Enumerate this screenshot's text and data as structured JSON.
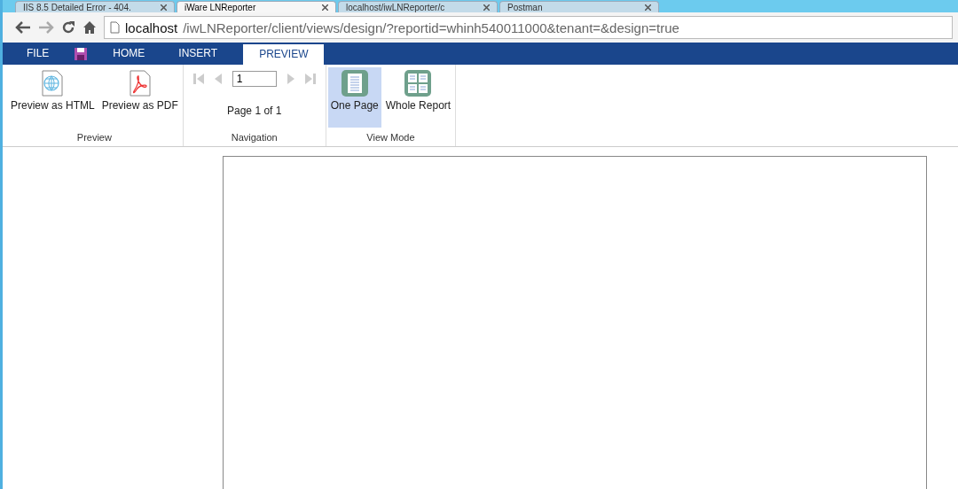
{
  "browser_tabs": [
    {
      "title": "IIS 8.5 Detailed Error - 404.",
      "selected": false
    },
    {
      "title": "iWare LNReporter",
      "selected": true
    },
    {
      "title": "localhost/iwLNReporter/c",
      "selected": false
    },
    {
      "title": "Postman",
      "selected": false
    }
  ],
  "address": {
    "host": "localhost",
    "path": "/iwLNReporter/client/views/design/?reportid=whinh540011000&tenant=&design=true"
  },
  "menu_tabs": [
    {
      "kind": "text",
      "label": "FILE",
      "selected": false
    },
    {
      "kind": "save",
      "selected": false
    },
    {
      "kind": "text",
      "label": "HOME",
      "selected": false
    },
    {
      "kind": "text",
      "label": "INSERT",
      "selected": false
    },
    {
      "kind": "text",
      "label": "PREVIEW",
      "selected": true
    }
  ],
  "ribbon_groups": [
    {
      "kind": "buttons",
      "label": "Preview",
      "items": [
        {
          "kind": "html",
          "label": "Preview as HTML",
          "selected": false
        },
        {
          "kind": "pdf",
          "label": "Preview as PDF",
          "selected": false
        }
      ]
    },
    {
      "kind": "navigation",
      "label": "Navigation",
      "page_input": "1",
      "status": "Page 1 of 1"
    },
    {
      "kind": "buttons",
      "label": "View Mode",
      "items": [
        {
          "kind": "one-page",
          "label": "One Page",
          "selected": true
        },
        {
          "kind": "whole-report",
          "label": "Whole Report",
          "selected": false
        }
      ]
    }
  ]
}
